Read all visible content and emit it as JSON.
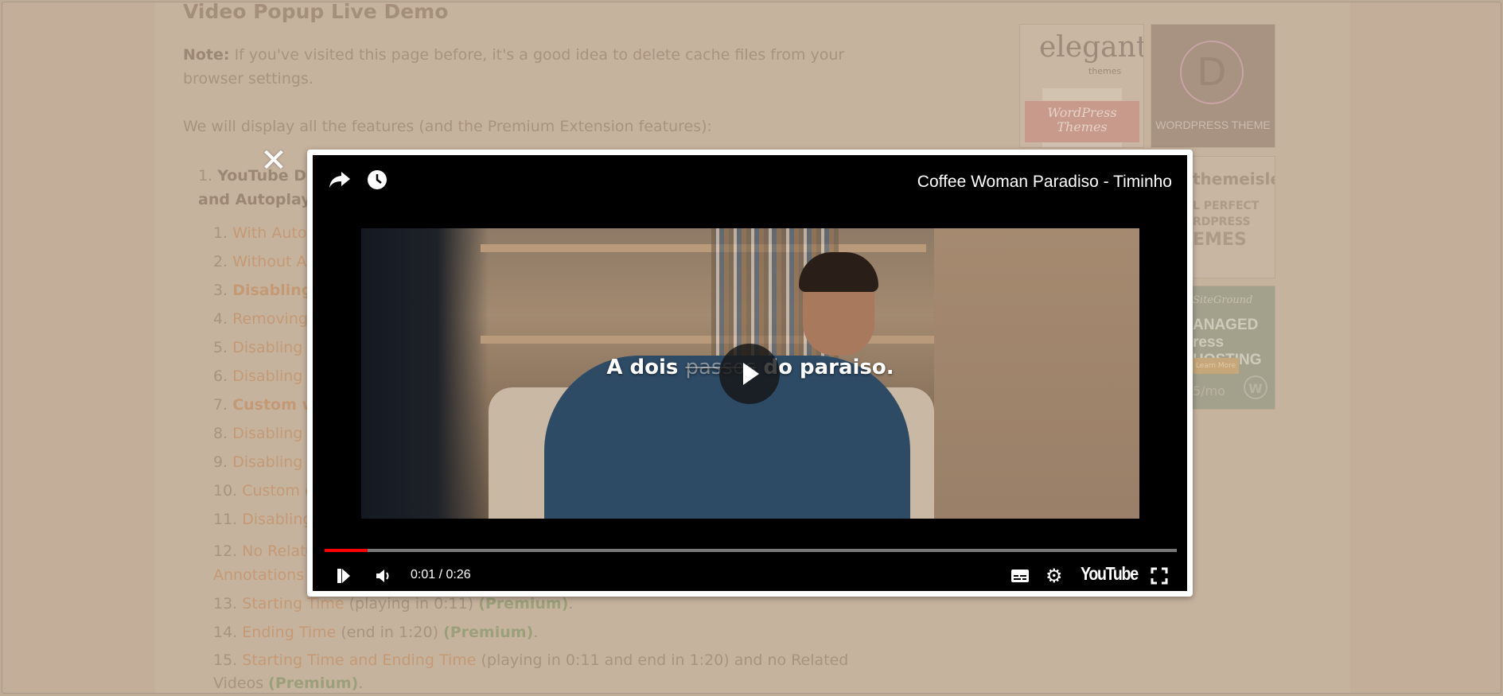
{
  "page": {
    "title": "Video Popup Live Demo",
    "note_label": "Note:",
    "note_text": " If you've visited this page before, it's a good idea to delete cache files from your browser settings.",
    "intro": "We will display all the features (and the Premium Extension features):",
    "list": {
      "item1_num": "1.",
      "item1_line1": "YouTube De",
      "item1_line2": "and Autoplay:",
      "sub": [
        {
          "num": "1.",
          "text": "With Autop",
          "style": "link"
        },
        {
          "num": "2.",
          "text": "Without Au",
          "style": "link"
        },
        {
          "num": "3.",
          "text": "Disabling",
          "style": "bold-link"
        },
        {
          "num": "4.",
          "text": "Removing",
          "style": "link"
        },
        {
          "num": "5.",
          "text": "Disabling t",
          "style": "link"
        },
        {
          "num": "6.",
          "text": "Disabling t",
          "style": "link"
        },
        {
          "num": "7.",
          "text": "Custom w",
          "style": "bold-link"
        },
        {
          "num": "8.",
          "text": "Disabling t",
          "style": "link"
        },
        {
          "num": "9.",
          "text": "Disabling t",
          "style": "link"
        },
        {
          "num": "10.",
          "text": "Custom c",
          "style": "link"
        },
        {
          "num": "11.",
          "text": "Disabling",
          "style": "link"
        }
      ],
      "item12_num": "12.",
      "item12_link": "No Relate",
      "item12_line2": "Annotations",
      "item13": {
        "num": "13.",
        "link": "Starting Time",
        "rest": " (playing in 0:11) ",
        "premium": "(Premium)",
        "end": "."
      },
      "item14": {
        "num": "14.",
        "link": "Ending Time",
        "rest": " (end in 1:20) ",
        "premium": "(Premium)",
        "end": "."
      },
      "item15": {
        "num": "15.",
        "link": "Starting Time and Ending Time",
        "rest": " (playing in 0:11 and end in 1:20) and no Related",
        "line2": "Videos ",
        "premium": "(Premium)",
        "end": "."
      }
    }
  },
  "sidebar_ads": {
    "elegant": {
      "logo": "elegant",
      "sub": "themes",
      "ribbon1": "WordPress",
      "ribbon2": "Themes"
    },
    "divi": {
      "letter": "D",
      "caption": "WORDPRESS THEME"
    },
    "themeisle": {
      "logo": "themeisle",
      "l1": "L PERFECT",
      "l2": "RDPRESS",
      "l3": "EMES"
    },
    "siteground": {
      "logo": "SiteGround",
      "l1": "ANAGED",
      "l2": "ress HOSTING",
      "button": "Learn More",
      "price": "5/mo"
    }
  },
  "popup": {
    "close_icon": "close-icon",
    "video_title": "Coffee Woman Paradiso - Timinho",
    "subtitle_before": "A dois ",
    "subtitle_faded": "passos",
    "subtitle_after": " do paraiso.",
    "time": "0:01 / 0:26",
    "progress_percent": 5,
    "brand": "YouTube",
    "colors": {
      "progress": "#ff0000",
      "track": "#777777"
    }
  }
}
